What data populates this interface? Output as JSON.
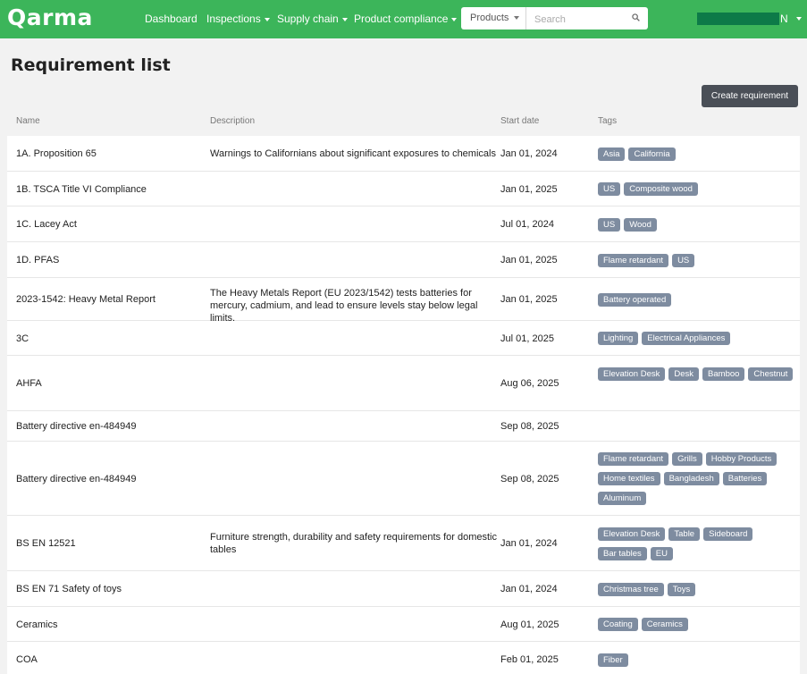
{
  "brand": {
    "logo": "Qarma"
  },
  "nav": {
    "items": [
      {
        "label": "Dashboard",
        "dropdown": false
      },
      {
        "label": "Inspections",
        "dropdown": true
      },
      {
        "label": "Supply chain",
        "dropdown": true
      },
      {
        "label": "Product compliance",
        "dropdown": true
      }
    ]
  },
  "search": {
    "category": "Products",
    "placeholder": "Search"
  },
  "user": {
    "initial": "N"
  },
  "page": {
    "title": "Requirement list",
    "create_button": "Create requirement"
  },
  "table": {
    "headers": {
      "name": "Name",
      "description": "Description",
      "start_date": "Start date",
      "tags": "Tags"
    },
    "rows": [
      {
        "name": "1A. Proposition 65",
        "description": "Warnings to Californians about significant exposures to chemicals",
        "start_date": "Jan 01, 2024",
        "tags": [
          "Asia",
          "California"
        ]
      },
      {
        "name": "1B. TSCA Title VI Compliance",
        "description": "",
        "start_date": "Jan 01, 2025",
        "tags": [
          "US",
          "Composite wood"
        ]
      },
      {
        "name": "1C. Lacey Act",
        "description": "",
        "start_date": "Jul 01, 2024",
        "tags": [
          "US",
          "Wood"
        ]
      },
      {
        "name": "1D. PFAS",
        "description": "",
        "start_date": "Jan 01, 2025",
        "tags": [
          "Flame retardant",
          "US"
        ]
      },
      {
        "name": "2023-1542: Heavy Metal Report",
        "description": "The Heavy Metals Report (EU 2023/1542) tests batteries for mercury, cadmium, and lead to ensure levels stay below legal limits.",
        "start_date": "Jan 01, 2025",
        "tags": [
          "Battery operated"
        ]
      },
      {
        "name": "3C",
        "description": "",
        "start_date": "Jul 01, 2025",
        "tags": [
          "Lighting",
          "Electrical Appliances"
        ]
      },
      {
        "name": "AHFA",
        "description": "",
        "start_date": "Aug 06, 2025",
        "tags": [
          "Elevation Desk",
          "Desk",
          "Bamboo",
          "Chestnut"
        ]
      },
      {
        "name": "Battery directive en-484949",
        "description": "",
        "start_date": "Sep 08, 2025",
        "tags": []
      },
      {
        "name": "Battery directive en-484949",
        "description": "",
        "start_date": "Sep 08, 2025",
        "tags": [
          "Flame retardant",
          "Grills",
          "Hobby Products",
          "Home textiles",
          "Bangladesh",
          "Batteries",
          "Aluminum"
        ]
      },
      {
        "name": "BS EN 12521",
        "description": "Furniture strength, durability and safety requirements for domestic tables",
        "start_date": "Jan 01, 2024",
        "tags": [
          "Elevation Desk",
          "Table",
          "Sideboard",
          "Bar tables",
          "EU"
        ]
      },
      {
        "name": "BS EN 71 Safety of toys",
        "description": "",
        "start_date": "Jan 01, 2024",
        "tags": [
          "Christmas tree",
          "Toys"
        ]
      },
      {
        "name": "Ceramics",
        "description": "",
        "start_date": "Aug 01, 2025",
        "tags": [
          "Coating",
          "Ceramics"
        ]
      },
      {
        "name": "COA",
        "description": "",
        "start_date": "Feb 01, 2025",
        "tags": [
          "Fiber"
        ]
      }
    ]
  }
}
